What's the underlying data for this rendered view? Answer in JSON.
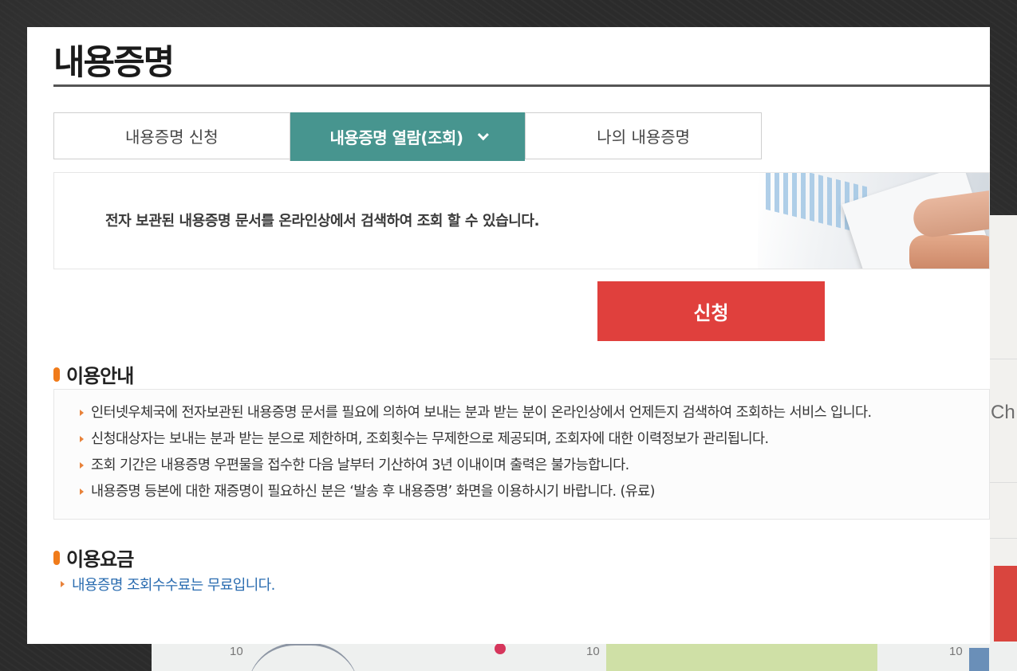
{
  "page": {
    "title": "내용증명"
  },
  "tabs": [
    {
      "label": "내용증명 신청"
    },
    {
      "label": "내용증명 열람(조회)"
    },
    {
      "label": "나의 내용증명"
    }
  ],
  "active_tab_index": 1,
  "banner": {
    "text": "전자 보관된 내용증명 문서를 온라인상에서 검색하여 조회 할 수 있습니다."
  },
  "apply_button": {
    "label": "신청"
  },
  "usage_guide": {
    "title": "이용안내",
    "items": [
      "인터넷우체국에 전자보관된 내용증명 문서를 필요에 의하여 보내는 분과 받는 분이 온라인상에서 언제든지 검색하여 조회하는 서비스 입니다.",
      "신청대상자는 보내는 분과 받는 분으로 제한하며, 조회횟수는 무제한으로 제공되며, 조회자에 대한 이력정보가 관리됩니다.",
      "조회 기간은 내용증명 우편물을 접수한 다음 날부터 기산하여 3년 이내이며 출력은 불가능합니다.",
      "내용증명 등본에 대한 재증명이 필요하신 분은 ‘발송 후 내용증명’ 화면을 이용하시기 바랍니다. (유료)"
    ]
  },
  "usage_fee": {
    "title": "이용요금",
    "text": "내용증명 조회수수료는 무료입니다."
  },
  "background": {
    "side_text": "Ch",
    "ticks": [
      "10",
      "10",
      "10"
    ]
  },
  "colors": {
    "tab_active": "#47958f",
    "apply_button": "#e0403d",
    "section_marker": "#f07b1a",
    "fee_text": "#2a6cb0"
  }
}
